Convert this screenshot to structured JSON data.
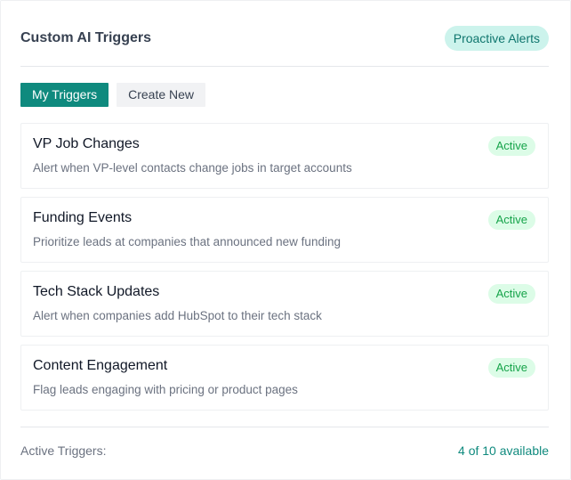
{
  "header": {
    "title": "Custom AI Triggers",
    "badge": "Proactive Alerts"
  },
  "tabs": [
    {
      "label": "My Triggers",
      "active": true
    },
    {
      "label": "Create New",
      "active": false
    }
  ],
  "triggers": [
    {
      "title": "VP Job Changes",
      "description": "Alert when VP-level contacts change jobs in target accounts",
      "status": "Active"
    },
    {
      "title": "Funding Events",
      "description": "Prioritize leads at companies that announced new funding",
      "status": "Active"
    },
    {
      "title": "Tech Stack Updates",
      "description": "Alert when companies add HubSpot to their tech stack",
      "status": "Active"
    },
    {
      "title": "Content Engagement",
      "description": "Flag leads engaging with pricing or product pages",
      "status": "Active"
    }
  ],
  "footer": {
    "label": "Active Triggers:",
    "value": "4 of 10 available"
  },
  "colors": {
    "accent": "#0f8a7e",
    "badge_bg": "#ccf3ec",
    "status_bg": "#dcfce7",
    "status_text": "#16a34a"
  }
}
